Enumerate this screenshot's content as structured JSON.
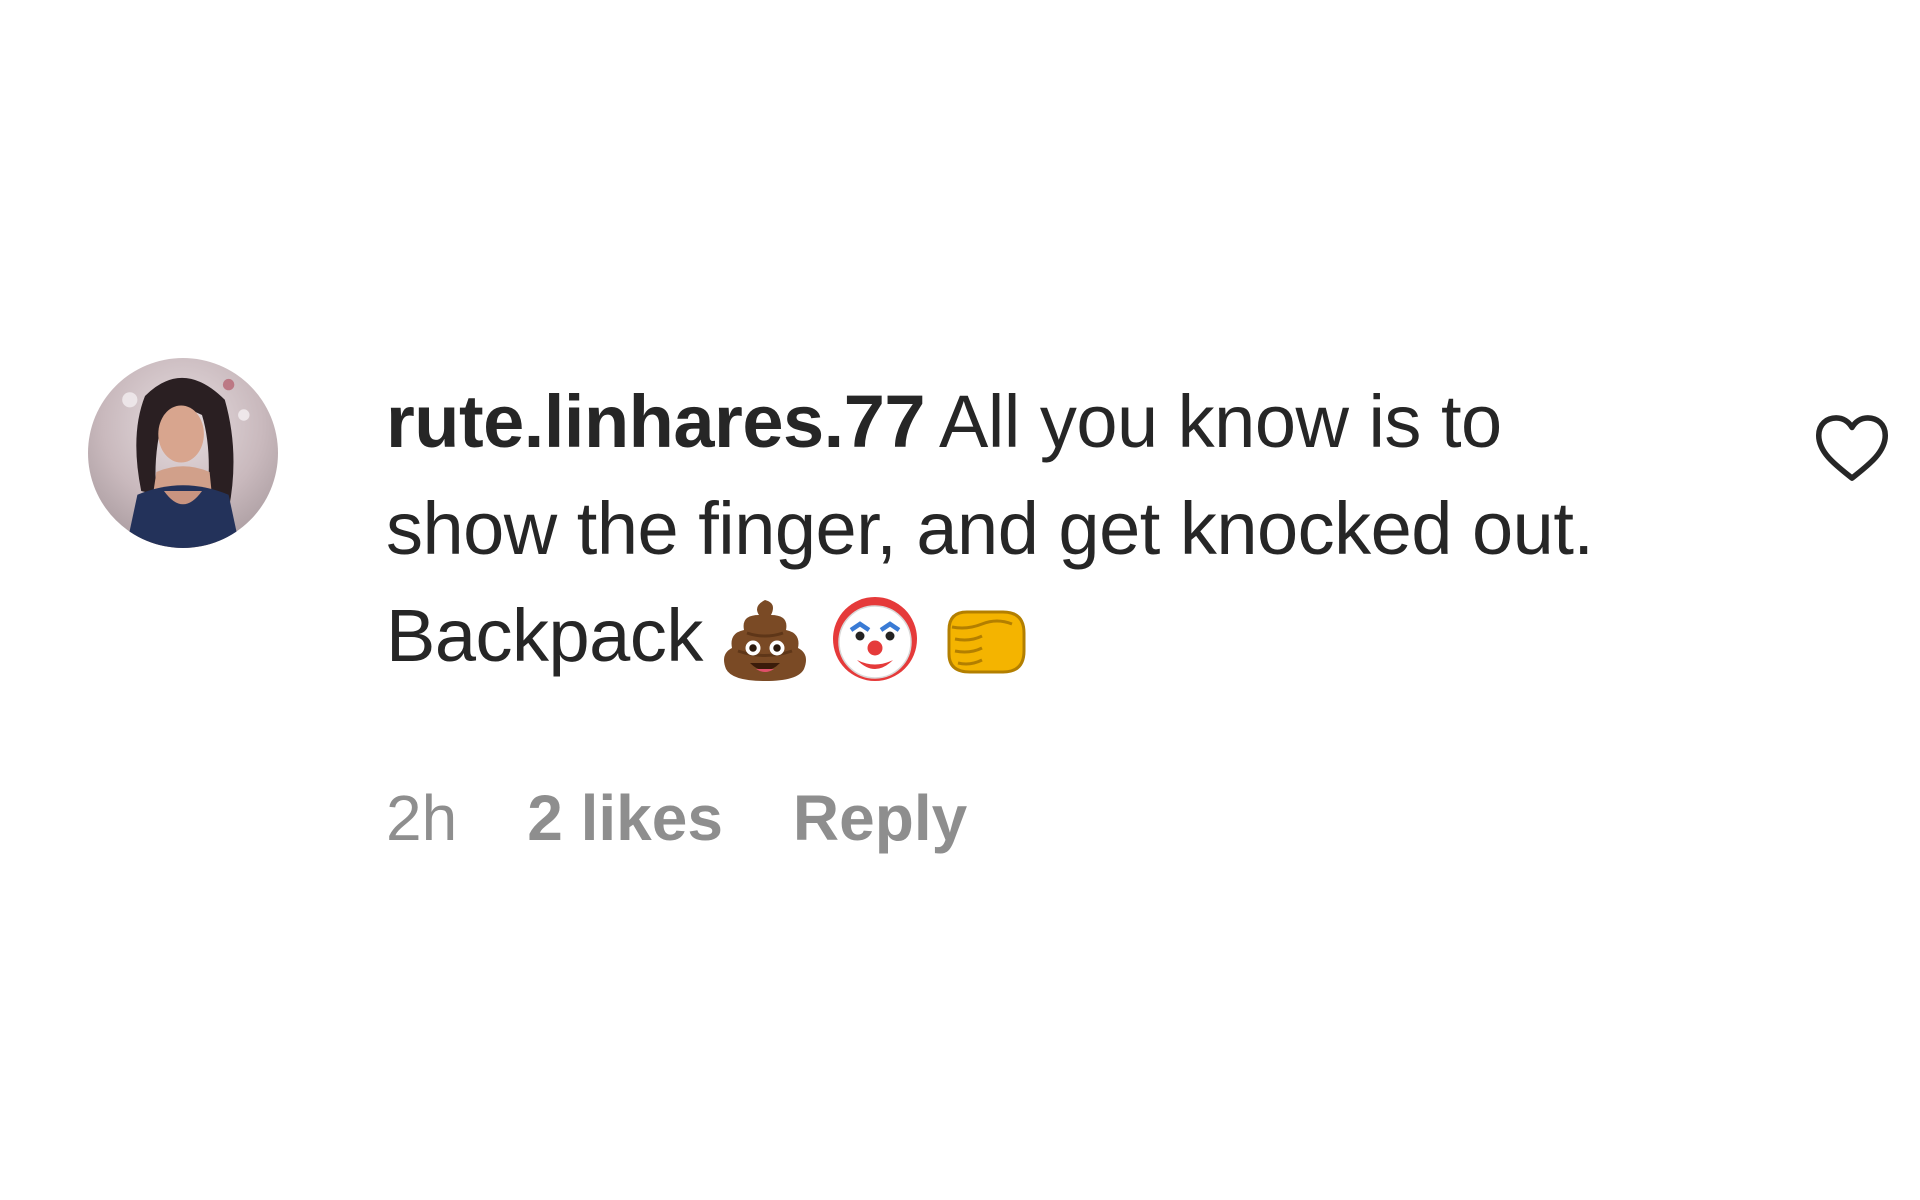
{
  "comment": {
    "username": "rute.linhares.77",
    "text": "All you know is to show the finger, and get knocked out. Backpack",
    "emojis": [
      "pile-of-poo-emoji",
      "clown-face-emoji",
      "oncoming-fist-emoji"
    ],
    "time": "2h",
    "likes": "2 likes",
    "reply_label": "Reply"
  },
  "icons": {
    "like": "heart-outline-icon"
  },
  "colors": {
    "text": "#262626",
    "meta": "#8e8e8e",
    "background": "#ffffff"
  }
}
